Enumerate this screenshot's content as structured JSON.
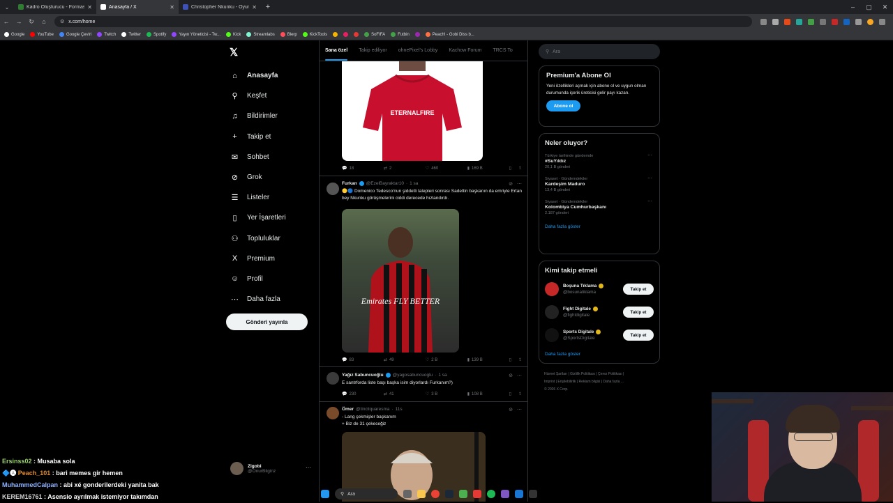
{
  "browser": {
    "tabs": [
      {
        "title": "Kadro Oluşturucu - Formasyon",
        "active": false,
        "color": "#2e7d32"
      },
      {
        "title": "Anasayfa / X",
        "active": true,
        "color": "#ffffff"
      },
      {
        "title": "Christopher Nkunku - Oyuncu",
        "active": false,
        "color": "#3f51b5"
      }
    ],
    "url": "x.com/home",
    "bookmarks": [
      {
        "label": "Google",
        "color": "#ffffff"
      },
      {
        "label": "YouTube",
        "color": "#ff0000"
      },
      {
        "label": "Google Çeviri",
        "color": "#4285f4"
      },
      {
        "label": "Twitch",
        "color": "#9146ff"
      },
      {
        "label": "Twitter",
        "color": "#ffffff"
      },
      {
        "label": "Spotify",
        "color": "#1db954"
      },
      {
        "label": "Yayın Yöneticisi - Tw...",
        "color": "#9146ff"
      },
      {
        "label": "Kick",
        "color": "#53fc18"
      },
      {
        "label": "Streamlabs",
        "color": "#80f5d2"
      },
      {
        "label": "Blerp",
        "color": "#ff4d5a"
      },
      {
        "label": "KickTools",
        "color": "#53fc18"
      },
      {
        "label": "",
        "color": "#f5b400"
      },
      {
        "label": "",
        "color": "#e91e63"
      },
      {
        "label": "",
        "color": "#e53935"
      },
      {
        "label": "SoFIFA",
        "color": "#43a047"
      },
      {
        "label": "Futbin",
        "color": "#43a047"
      },
      {
        "label": "",
        "color": "#9c27b0"
      },
      {
        "label": "Peach! - Gobi Diss b...",
        "color": "#ff7043"
      }
    ]
  },
  "nav": {
    "items": [
      {
        "label": "Anasayfa",
        "icon": "home-icon",
        "glyph": "⌂",
        "active": true
      },
      {
        "label": "Keşfet",
        "icon": "search-icon",
        "glyph": "⚲",
        "active": false
      },
      {
        "label": "Bildirimler",
        "icon": "bell-icon",
        "glyph": "♫",
        "active": false
      },
      {
        "label": "Takip et",
        "icon": "follow-icon",
        "glyph": "+",
        "active": false
      },
      {
        "label": "Sohbet",
        "icon": "mail-icon",
        "glyph": "✉",
        "active": false
      },
      {
        "label": "Grok",
        "icon": "grok-icon",
        "glyph": "⊘",
        "active": false
      },
      {
        "label": "Listeler",
        "icon": "list-icon",
        "glyph": "☰",
        "active": false
      },
      {
        "label": "Yer İşaretleri",
        "icon": "bookmark-icon",
        "glyph": "▯",
        "active": false
      },
      {
        "label": "Topluluklar",
        "icon": "communities-icon",
        "glyph": "⚇",
        "active": false
      },
      {
        "label": "Premium",
        "icon": "x-premium-icon",
        "glyph": "X",
        "active": false
      },
      {
        "label": "Profil",
        "icon": "profile-icon",
        "glyph": "☺",
        "active": false
      },
      {
        "label": "Daha fazla",
        "icon": "more-icon",
        "glyph": "⋯",
        "active": false
      }
    ],
    "post_button": "Gönderi yayınla",
    "account": {
      "name": "Zigobi",
      "handle": "@OnurBilginz"
    }
  },
  "timeline": {
    "tabs": [
      "Sana özel",
      "Takip ediliyor",
      "ohnePixel's Lobby",
      "Kachow Forum",
      "TRCS To"
    ],
    "first_post": {
      "replies": "18",
      "reposts": "2",
      "likes": "460",
      "views": "169 B",
      "jersey_sponsor": "ETERNALFIRE"
    },
    "tweets": [
      {
        "name": "Furkan",
        "handle": "@EzelBayraktar10",
        "time": "1 sa",
        "text": "🟡🔵 Domenico Tedesco'nun şiddetli talepleri sonrası Sadettin başkanın da emriyle Ertan bey Nkunku görüşmelerini ciddi derecede hızlandırdı.",
        "replies": "83",
        "reposts": "49",
        "likes": "2 B",
        "views": "139 B",
        "image_caption": "Emirates FLY BETTER"
      },
      {
        "name": "Yağız Sabuncuoğlu",
        "handle": "@yagosabuncuoglu",
        "time": "1 sa",
        "text": "E santrforda liste başı başka isim diyorlardı Furkanım?)",
        "replies": "230",
        "reposts": "41",
        "likes": "3 B",
        "views": "108 B"
      },
      {
        "name": "Ömer",
        "handle": "@tincliquaresma",
        "time": "11s",
        "text_line1": "- Lang çekmişler başkanım",
        "text_line2": "+ Biz de 31 çekeceğiz"
      }
    ]
  },
  "right": {
    "search_placeholder": "Ara",
    "premium": {
      "title": "Premium'a Abone Ol",
      "body": "Yeni özellikleri açmak için abone ol ve uygun olman durumunda içerik üreticisi gelir payı kazan.",
      "button": "Abone ol"
    },
    "trends": {
      "title": "Neler oluyor?",
      "items": [
        {
          "context": "Türkiye tarihinde gündemde",
          "name": "#SuYıldız",
          "count": "20,1 B gönderi"
        },
        {
          "context": "Siyaset · Gündemdekiler",
          "name": "Kardeşim Maduro",
          "count": "13,4 B gönderi"
        },
        {
          "context": "Siyaset · Gündemdekiler",
          "name": "Kolombiya Cumhurbaşkanı",
          "count": "2.187 gönderi"
        }
      ],
      "show_more": "Daha fazla göster"
    },
    "who_to_follow": {
      "title": "Kimi takip etmeli",
      "items": [
        {
          "name": "Boşuna Tıklama",
          "handle": "@bosunatiklama",
          "button": "Takip et",
          "avatar_color": "#c62828"
        },
        {
          "name": "Fight Digitale",
          "handle": "@fightdigitale",
          "button": "Takip et",
          "avatar_color": "#222222"
        },
        {
          "name": "Sports Digitale",
          "handle": "@SportsDigitale",
          "button": "Takip et",
          "avatar_color": "#111111"
        }
      ],
      "show_more": "Daha fazla göster"
    },
    "footer": {
      "line1": "Hizmet Şartları | Gizlilik Politikası | Çerez Politikası |",
      "line2": "Imprint | Erişilebilirlik | Reklam bilgisi | Daha fazla ...",
      "line3": "© 2026 X Corp."
    }
  },
  "chat": [
    {
      "user": "Ersinss02",
      "message": ": Musaba sola",
      "prefix": ""
    },
    {
      "user": "Peach_101",
      "message": ": bari memes gir hemen",
      "prefix": "🔷🅐 "
    },
    {
      "user": "MuhammedCalpan",
      "message": ": abi xé gonderilerdeki yanita bak",
      "prefix": ""
    },
    {
      "user": "KEREM16761",
      "message": ": Asensio ayrılmak istemiyor takımdan",
      "prefix": ""
    }
  ],
  "taskbar": {
    "search_label": "Ara"
  }
}
